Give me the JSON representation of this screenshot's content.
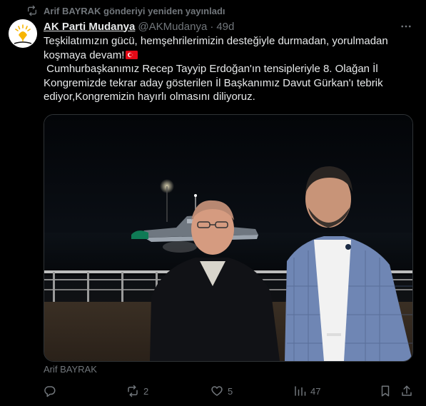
{
  "repost": {
    "text": "Arif BAYRAK gönderiyi yeniden yayınladı"
  },
  "author": {
    "name": "AK Parti Mudanya",
    "handle": "@AKMudanya",
    "separator": "·",
    "time": "49d",
    "avatar_icon": "ak-parti-logo-icon"
  },
  "tweet": {
    "line1": "Teşkilatımızın gücü, hemşehrilerimizin desteğiyle durmadan, yorulmadan koşmaya devam!",
    "flag_icon": "turkey-flag-icon",
    "line2": " Cumhurbaşkanımız Recep Tayyip Erdoğan'ın tensipleriyle 8. Olağan İl Kongremizde tekrar aday gösterilen İl Başkanımız Davut Gürkan'ı tebrik ediyor,Kongremizin hayırlı olmasını diliyoruz."
  },
  "media": {
    "photo_credit": "Arif BAYRAK"
  },
  "actions": {
    "reply_count": "",
    "repost_count": "2",
    "like_count": "5",
    "views_count": "47"
  },
  "colors": {
    "background": "#000000",
    "text": "#e7e9ea",
    "muted": "#71767b",
    "border": "#2f3336",
    "brand_yellow": "#f7b500",
    "flag_red": "#e30a17"
  }
}
